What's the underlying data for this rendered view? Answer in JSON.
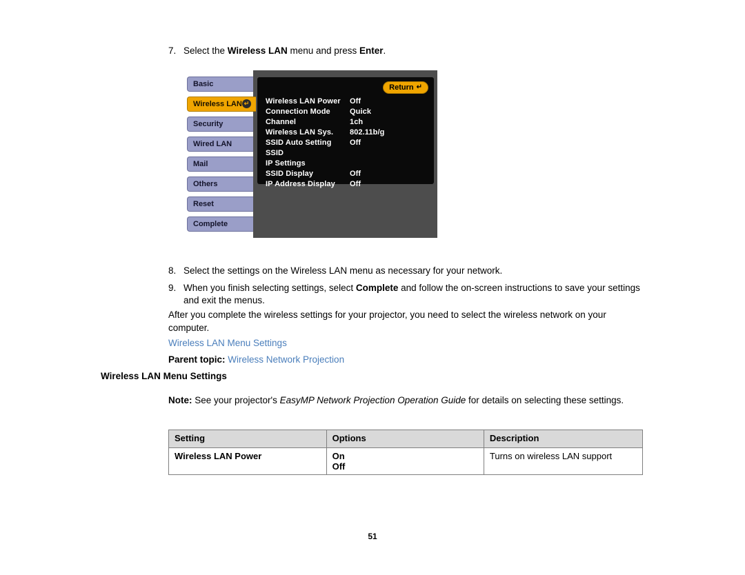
{
  "steps": [
    {
      "num": "7.",
      "parts": [
        "Select the ",
        "Wireless LAN",
        " menu and press ",
        "Enter",
        "."
      ]
    },
    {
      "num": "8.",
      "text": "Select the settings on the Wireless LAN menu as necessary for your network."
    },
    {
      "num": "9.",
      "parts": [
        "When you finish selecting settings, select ",
        "Complete",
        " and follow the on-screen instructions to save your settings and exit the menus."
      ]
    }
  ],
  "projector_menu": {
    "return_label": "Return",
    "return_icon": "return-arrow-icon",
    "tabs": [
      {
        "label": "Basic",
        "selected": false
      },
      {
        "label": "Wireless LAN",
        "selected": true,
        "icon": "enter-icon"
      },
      {
        "label": "Security",
        "selected": false
      },
      {
        "label": "Wired LAN",
        "selected": false
      },
      {
        "label": "Mail",
        "selected": false
      },
      {
        "label": "Others",
        "selected": false
      },
      {
        "label": "Reset",
        "selected": false
      },
      {
        "label": "Complete",
        "selected": false
      }
    ],
    "rows": [
      {
        "label": "Wireless LAN Power",
        "value": "Off"
      },
      {
        "label": "Connection Mode",
        "value": "Quick"
      },
      {
        "label": "Channel",
        "value": "1ch"
      },
      {
        "label": "Wireless LAN Sys.",
        "value": "802.11b/g"
      },
      {
        "label": "SSID Auto Setting",
        "value": "Off"
      },
      {
        "label": "SSID",
        "value": ""
      },
      {
        "label": "IP Settings",
        "value": ""
      },
      {
        "label": "SSID Display",
        "value": "Off"
      },
      {
        "label": "IP Address Display",
        "value": "Off"
      }
    ]
  },
  "after_paragraph": "After you complete the wireless settings for your projector, you need to select the wireless network on your computer.",
  "links": {
    "wireless_lan_menu_settings": "Wireless LAN Menu Settings",
    "parent_topic_label": "Parent topic:",
    "parent_topic_link": "Wireless Network Projection"
  },
  "section_heading": "Wireless LAN Menu Settings",
  "note": {
    "label": "Note:",
    "before_italic": " See your projector's ",
    "italic": "EasyMP Network Projection Operation Guide",
    "after_italic": " for details on selecting these settings."
  },
  "table": {
    "headers": [
      "Setting",
      "Options",
      "Description"
    ],
    "rows": [
      {
        "setting": "Wireless LAN Power",
        "options": [
          "On",
          "Off"
        ],
        "description": "Turns on wireless LAN support"
      }
    ]
  },
  "page_number": "51"
}
